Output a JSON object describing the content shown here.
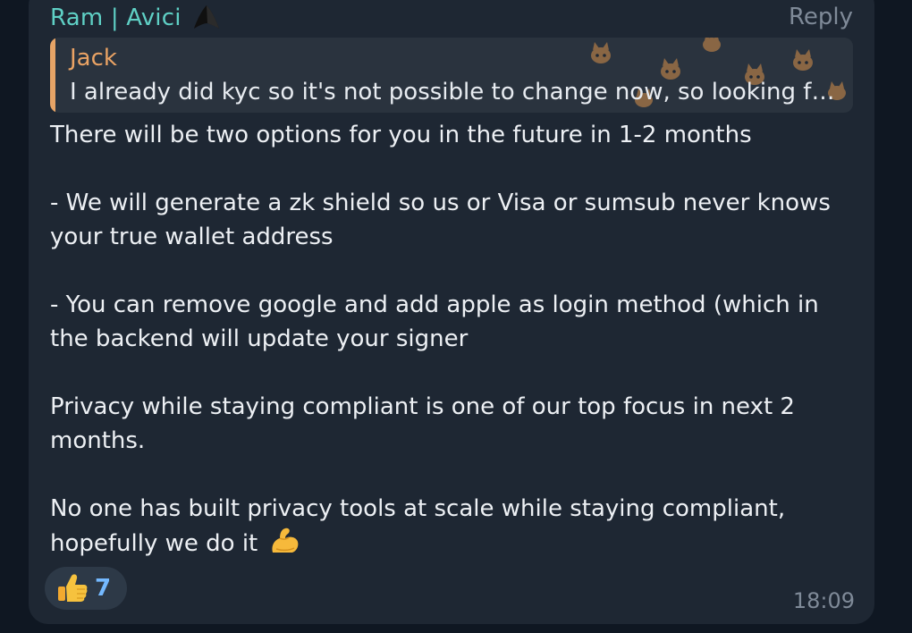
{
  "message": {
    "sender": "Ram | Avici",
    "reply_label": "Reply",
    "quote": {
      "author": "Jack",
      "text": "I already did kyc so it's not possible to change now, so looking fo..."
    },
    "paragraphs": [
      "There will be two options for you in the future in 1-2 months",
      "- We will generate a zk shield so us or Visa or sumsub never knows your true wallet address",
      "- You can remove google and add apple as login method (which in the backend will update your signer",
      "Privacy while staying compliant is one of our top focus in next 2 months.",
      "No one has built privacy tools at scale while staying compliant, hopefully we do it"
    ],
    "reaction": {
      "emoji": "thumbs-up-emoji",
      "count": "7"
    },
    "time": "18:09"
  },
  "colors": {
    "background": "#0f1722",
    "bubble": "#1e2733",
    "sender": "#5fd0c5",
    "quote_accent": "#e6a466",
    "meta_text": "#7f8a98",
    "reaction_count": "#74b9ff"
  },
  "icons": [
    "sender-badge-icon",
    "cat-pattern-icon",
    "flexed-biceps-emoji",
    "thumbs-up-emoji"
  ]
}
